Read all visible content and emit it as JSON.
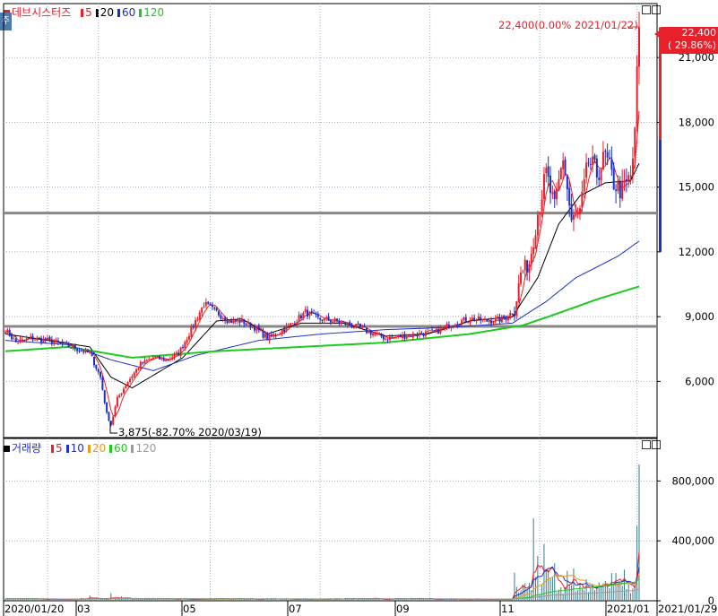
{
  "main": {
    "side_tab": "주",
    "title": "데브시스터즈",
    "ma_legend": [
      {
        "label": "5",
        "color": "#e8202a"
      },
      {
        "label": "20",
        "color": "#000000"
      },
      {
        "label": "60",
        "color": "#1c2fc9"
      },
      {
        "label": "120",
        "color": "#1ec91e"
      }
    ],
    "price_badge": {
      "price": "22,400",
      "change": "( 29.86%)"
    },
    "annotation_high": "22,400(0.00% 2021/01/22)",
    "annotation_low": "3,875(-82.70% 2020/03/19)"
  },
  "volume": {
    "title": "거래량",
    "ma_legend": [
      {
        "label": "5",
        "color": "#e8202a"
      },
      {
        "label": "10",
        "color": "#1c2fc9"
      },
      {
        "label": "20",
        "color": "#e89a1e"
      },
      {
        "label": "60",
        "color": "#1ec91e"
      },
      {
        "label": "120",
        "color": "#9a9a9a"
      }
    ]
  },
  "colors": {
    "up": "#e8202a",
    "down": "#1c2fc9",
    "grid": "#9fb0c8",
    "hline": "#888888"
  },
  "chart_data": [
    {
      "type": "candlestick",
      "title": "데브시스터즈",
      "ylim": [
        3400,
        23500
      ],
      "y_ticks": [
        6000,
        9000,
        12000,
        15000,
        18000,
        21000
      ],
      "y_tick_labels": [
        "6,000",
        "9,000",
        "12,000",
        "15,000",
        "18,000",
        "21,000"
      ],
      "x_labels": [
        "2020/01/20",
        "03",
        "05",
        "07",
        "09",
        "11",
        "2021/01",
        "2021/01/29"
      ],
      "horizontal_lines": [
        8550,
        13800
      ],
      "last_price": 22400,
      "last_change_pct": 29.86,
      "high": {
        "value": 22400,
        "date": "2021/01/22",
        "pct": 0.0
      },
      "low": {
        "value": 3875,
        "date": "2020/03/19",
        "pct": -82.7
      },
      "close_anchors": [
        [
          0,
          8400
        ],
        [
          5,
          7800
        ],
        [
          12,
          8000
        ],
        [
          20,
          7900
        ],
        [
          28,
          7700
        ],
        [
          34,
          7500
        ],
        [
          40,
          7300
        ],
        [
          45,
          6200
        ],
        [
          48,
          4500
        ],
        [
          50,
          4000
        ],
        [
          53,
          5200
        ],
        [
          58,
          6000
        ],
        [
          64,
          6800
        ],
        [
          70,
          7100
        ],
        [
          76,
          7000
        ],
        [
          82,
          7300
        ],
        [
          88,
          8400
        ],
        [
          94,
          9600
        ],
        [
          100,
          9200
        ],
        [
          106,
          8800
        ],
        [
          112,
          8800
        ],
        [
          118,
          8500
        ],
        [
          124,
          8000
        ],
        [
          130,
          8300
        ],
        [
          136,
          8700
        ],
        [
          142,
          9200
        ],
        [
          148,
          8900
        ],
        [
          156,
          8800
        ],
        [
          164,
          8600
        ],
        [
          172,
          8300
        ],
        [
          180,
          8000
        ],
        [
          188,
          8100
        ],
        [
          196,
          8200
        ],
        [
          204,
          8300
        ],
        [
          212,
          8700
        ],
        [
          220,
          8900
        ],
        [
          228,
          8800
        ],
        [
          236,
          8900
        ],
        [
          241,
          9300
        ],
        [
          244,
          11000
        ],
        [
          248,
          11500
        ],
        [
          252,
          13800
        ],
        [
          256,
          15600
        ],
        [
          260,
          14000
        ],
        [
          264,
          16400
        ],
        [
          268,
          13400
        ],
        [
          272,
          13800
        ],
        [
          276,
          16200
        ],
        [
          280,
          15600
        ],
        [
          284,
          16400
        ],
        [
          288,
          15200
        ],
        [
          292,
          14800
        ],
        [
          296,
          15500
        ],
        [
          298,
          17300
        ],
        [
          299,
          20500
        ],
        [
          300,
          22400
        ]
      ],
      "ma": [
        {
          "name": "5",
          "color": "#e8202a"
        },
        {
          "name": "20",
          "color": "#000000",
          "values": [
            [
              0,
              8200
            ],
            [
              20,
              7900
            ],
            [
              40,
              7600
            ],
            [
              50,
              6200
            ],
            [
              60,
              5700
            ],
            [
              72,
              6400
            ],
            [
              84,
              7100
            ],
            [
              100,
              8800
            ],
            [
              112,
              8900
            ],
            [
              124,
              8200
            ],
            [
              140,
              8700
            ],
            [
              160,
              8700
            ],
            [
              180,
              8100
            ],
            [
              200,
              8200
            ],
            [
              220,
              8800
            ],
            [
              240,
              9000
            ],
            [
              252,
              10800
            ],
            [
              262,
              13300
            ],
            [
              272,
              14600
            ],
            [
              284,
              15200
            ],
            [
              296,
              15300
            ],
            [
              300,
              16100
            ]
          ]
        },
        {
          "name": "60",
          "color": "#1c2fc9",
          "values": [
            [
              0,
              7900
            ],
            [
              30,
              7700
            ],
            [
              50,
              7000
            ],
            [
              70,
              6500
            ],
            [
              90,
              7200
            ],
            [
              120,
              7900
            ],
            [
              150,
              8200
            ],
            [
              180,
              8400
            ],
            [
              210,
              8500
            ],
            [
              240,
              8700
            ],
            [
              256,
              9700
            ],
            [
              270,
              10800
            ],
            [
              290,
              11800
            ],
            [
              300,
              12500
            ]
          ]
        },
        {
          "name": "120",
          "color": "#1ec91e",
          "values": [
            [
              0,
              7400
            ],
            [
              30,
              7600
            ],
            [
              60,
              7100
            ],
            [
              100,
              7400
            ],
            [
              140,
              7600
            ],
            [
              180,
              7800
            ],
            [
              220,
              8200
            ],
            [
              245,
              8600
            ],
            [
              260,
              9100
            ],
            [
              280,
              9800
            ],
            [
              300,
              10400
            ]
          ]
        }
      ]
    },
    {
      "type": "bar",
      "title": "거래량",
      "ylim": [
        0,
        1000000
      ],
      "y_ticks": [
        0,
        400000,
        800000
      ],
      "y_tick_labels": [
        "0",
        "400,000",
        "800,000"
      ],
      "baseline_volume": 12000,
      "spikes": [
        [
          40,
          35000
        ],
        [
          50,
          50000
        ],
        [
          55,
          30000
        ],
        [
          70,
          20000
        ],
        [
          95,
          15000
        ],
        [
          250,
          550000
        ],
        [
          252,
          300000
        ],
        [
          255,
          380000
        ],
        [
          260,
          250000
        ],
        [
          266,
          200000
        ],
        [
          272,
          120000
        ],
        [
          285,
          100000
        ],
        [
          299,
          500000
        ],
        [
          300,
          910000
        ]
      ],
      "ma": [
        {
          "name": "5",
          "color": "#e8202a"
        },
        {
          "name": "10",
          "color": "#1c2fc9"
        },
        {
          "name": "20",
          "color": "#e89a1e"
        },
        {
          "name": "60",
          "color": "#1ec91e"
        },
        {
          "name": "120",
          "color": "#9a9a9a"
        }
      ]
    }
  ]
}
